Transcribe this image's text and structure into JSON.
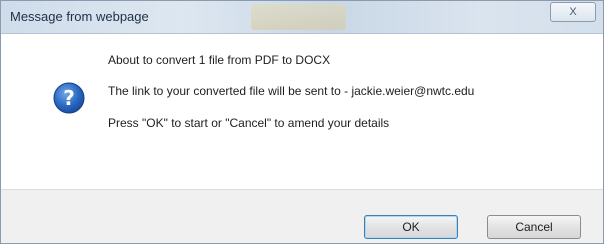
{
  "window": {
    "title": "Message from webpage",
    "close_label": "X"
  },
  "message": {
    "icon": "question-icon",
    "line1": "About to convert 1 file from PDF to DOCX",
    "line2": "The link to your converted file will be sent to - jackie.weier@nwtc.edu",
    "line3": "Press \"OK\" to start or \"Cancel\" to amend your details"
  },
  "buttons": {
    "ok_label": "OK",
    "cancel_label": "Cancel"
  },
  "colors": {
    "icon_blue": "#1f5fb5",
    "titlebar": "#d3dfeb"
  }
}
